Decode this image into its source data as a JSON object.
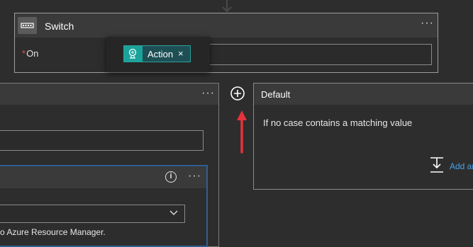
{
  "switch": {
    "title": "Switch",
    "more": "···",
    "on_required": "*",
    "on_label": "On"
  },
  "token": {
    "label": "Action",
    "close": "×"
  },
  "case_card": {
    "more": "···"
  },
  "inner_card": {
    "info": "i",
    "more": "···",
    "text": "o Azure Resource Manager."
  },
  "default_card": {
    "title": "Default",
    "description": "If no case contains a matching value",
    "add_action_label": "Add an"
  },
  "colors": {
    "token_accent": "#1aa39b",
    "annotation_arrow": "#e5323b",
    "link": "#4aa3e8"
  }
}
